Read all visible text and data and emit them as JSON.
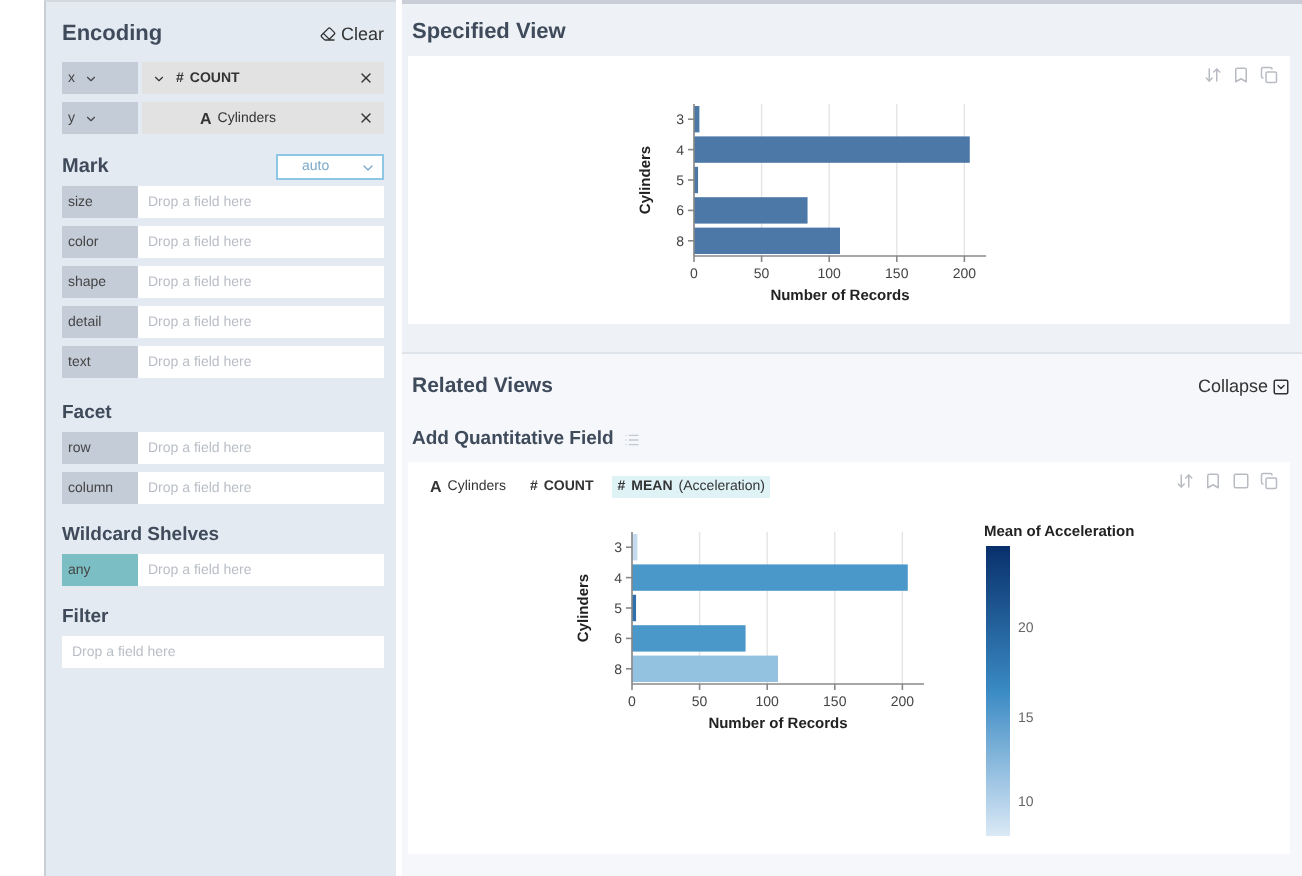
{
  "encoding": {
    "title": "Encoding",
    "clear_label": "Clear",
    "positional": [
      {
        "channel": "x",
        "field": {
          "type_symbol": "#",
          "name": "COUNT",
          "caret": true
        }
      },
      {
        "channel": "y",
        "field": {
          "type_symbol": "A",
          "name": "Cylinders",
          "caret": false
        }
      }
    ]
  },
  "mark": {
    "title": "Mark",
    "value": "auto",
    "channels": [
      {
        "channel": "size",
        "placeholder": "Drop a field here"
      },
      {
        "channel": "color",
        "placeholder": "Drop a field here"
      },
      {
        "channel": "shape",
        "placeholder": "Drop a field here"
      },
      {
        "channel": "detail",
        "placeholder": "Drop a field here"
      },
      {
        "channel": "text",
        "placeholder": "Drop a field here"
      }
    ]
  },
  "facet": {
    "title": "Facet",
    "channels": [
      {
        "channel": "row",
        "placeholder": "Drop a field here"
      },
      {
        "channel": "column",
        "placeholder": "Drop a field here"
      }
    ]
  },
  "wildcard": {
    "title": "Wildcard Shelves",
    "channels": [
      {
        "channel": "any",
        "placeholder": "Drop a field here"
      }
    ]
  },
  "filter": {
    "title": "Filter",
    "placeholder": "Drop a field here"
  },
  "specified_view": {
    "title": "Specified View",
    "chart_data": {
      "type": "bar",
      "orientation": "horizontal",
      "xlabel": "Number of Records",
      "ylabel": "Cylinders",
      "categories": [
        "3",
        "4",
        "5",
        "6",
        "8"
      ],
      "series": [
        {
          "color": "#4c78a8",
          "values": [
            4,
            204,
            3,
            84,
            108
          ]
        }
      ],
      "xlim": [
        0,
        216
      ],
      "xticks": [
        0,
        50,
        100,
        150,
        200
      ],
      "grid": true
    }
  },
  "related_views": {
    "title": "Related Views",
    "collapse_label": "Collapse",
    "group_title": "Add Quantitative Field",
    "fields": [
      {
        "type_symbol": "A",
        "name": "Cylinders",
        "highlighted": false
      },
      {
        "type_symbol": "#",
        "name": "COUNT",
        "highlighted": false
      },
      {
        "type_symbol": "#",
        "name": "MEAN",
        "argument": "(Acceleration)",
        "highlighted": true
      }
    ],
    "chart_data": {
      "type": "bar",
      "orientation": "horizontal",
      "xlabel": "Number of Records",
      "ylabel": "Cylinders",
      "categories": [
        "3",
        "4",
        "5",
        "6",
        "8"
      ],
      "series": [
        {
          "values": [
            4,
            204,
            3,
            84,
            108
          ]
        }
      ],
      "xlim": [
        0,
        216
      ],
      "xticks": [
        0,
        50,
        100,
        150,
        200
      ],
      "grid": true
    },
    "bar_colors": [
      {
        "color": "#c6dbef"
      },
      {
        "color": "#4a98c9"
      },
      {
        "color": "#2f6fac"
      },
      {
        "color": "#4a98c9"
      },
      {
        "color": "#92c2df"
      }
    ],
    "legend": {
      "title": "Mean of Acceleration",
      "ticks": [
        "20",
        "15",
        "10"
      ]
    }
  }
}
